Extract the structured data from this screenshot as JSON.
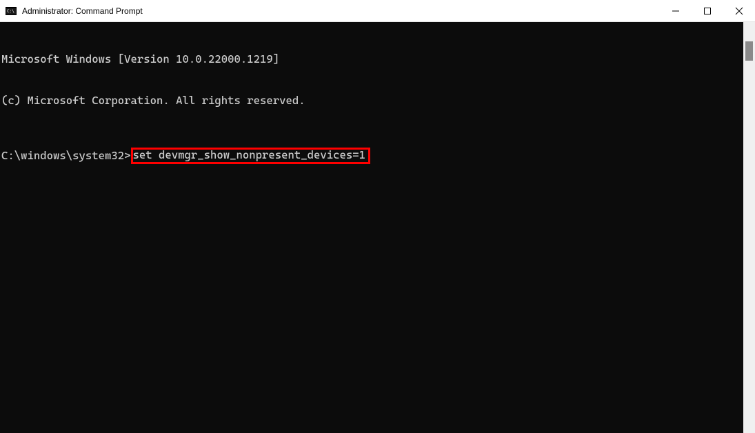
{
  "titlebar": {
    "title": "Administrator: Command Prompt",
    "icon_name": "cmd-icon"
  },
  "window_controls": {
    "minimize_name": "minimize-icon",
    "maximize_name": "maximize-icon",
    "close_name": "close-icon"
  },
  "terminal": {
    "line1": "Microsoft Windows [Version 10.0.22000.1219]",
    "line2": "(c) Microsoft Corporation. All rights reserved.",
    "prompt": "C:\\windows\\system32>",
    "command": "set devmgr_show_nonpresent_devices=1"
  },
  "annotation": {
    "highlight_color": "#ff0000"
  }
}
